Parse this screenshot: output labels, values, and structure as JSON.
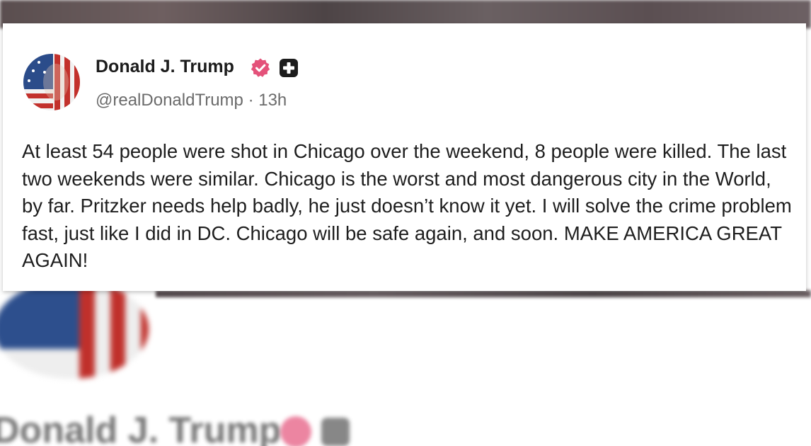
{
  "post": {
    "display_name": "Donald J. Trump",
    "handle": "@realDonaldTrump",
    "separator": "·",
    "timestamp": "13h",
    "verified_icon": "verified-badge-icon",
    "plus_icon": "plus-badge-icon",
    "text": "At least 54 people were shot in Chicago over the weekend, 8 people were killed. The last two weekends were similar. Chicago is the worst and most dangerous city in the World, by far. Pritzker needs help badly, he just doesn’t know it yet. I will solve the crime problem fast, just like I did in DC. Chicago will be safe again, and soon. MAKE AMERICA GREAT AGAIN!"
  },
  "background": {
    "blurred_name": "Donald J. Trump"
  },
  "colors": {
    "verified_badge": "#e4527a",
    "plus_badge": "#1c1c1c",
    "text_primary": "#1e1e1e",
    "text_secondary": "#6b6b6b"
  }
}
